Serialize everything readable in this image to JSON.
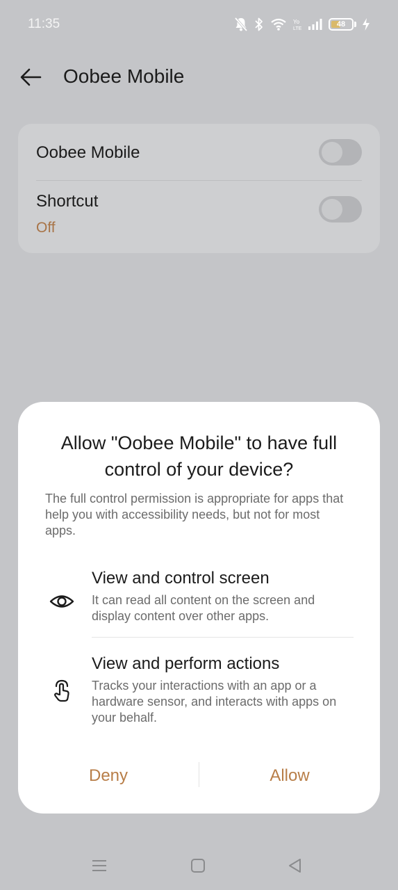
{
  "status_bar": {
    "time": "11:35",
    "battery_level": "48",
    "battery_fraction": 0.48,
    "icons": [
      "bell-muted-icon",
      "bluetooth-icon",
      "wifi-icon",
      "volte-icon",
      "signal-icon",
      "battery-icon",
      "charging-icon"
    ]
  },
  "header": {
    "title": "Oobee Mobile",
    "back_icon": "arrow-left-icon"
  },
  "settings": {
    "rows": [
      {
        "label": "Oobee Mobile",
        "toggle_on": false
      },
      {
        "label": "Shortcut",
        "sub": "Off",
        "toggle_on": false
      }
    ]
  },
  "dialog": {
    "title": "Allow \"Oobee Mobile\" to have full control of your device?",
    "description": "The full control permission is appropriate for apps that help you with accessibility needs, but not for most apps.",
    "permissions": [
      {
        "icon": "eye-icon",
        "title": "View and control screen",
        "description": "It can read all content on the screen and display content over other apps."
      },
      {
        "icon": "touch-hand-icon",
        "title": "View and perform actions",
        "description": "Tracks your interactions with an app or a hardware sensor, and interacts with apps on your behalf."
      }
    ],
    "deny_label": "Deny",
    "allow_label": "Allow"
  },
  "nav_bar": {
    "icons": [
      "menu-icon",
      "home-square-icon",
      "back-triangle-icon"
    ]
  },
  "colors": {
    "accent": "#b87e48",
    "scrim_background": "#c4c5c8",
    "dialog_background": "#ffffff"
  }
}
